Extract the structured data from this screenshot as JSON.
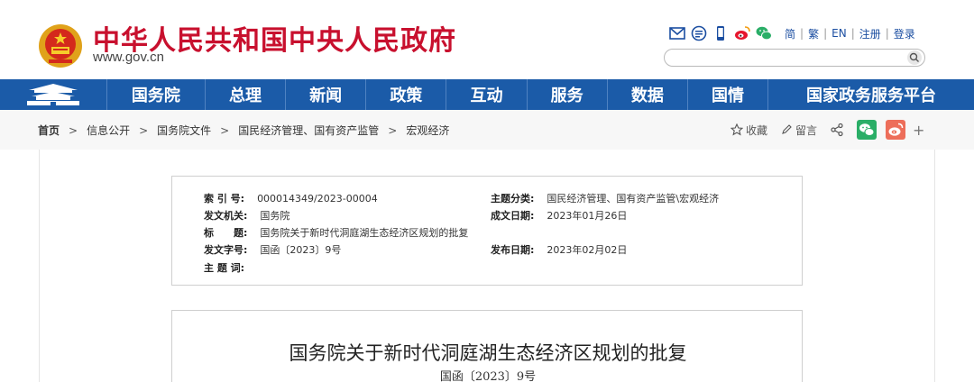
{
  "header": {
    "title": "中华人民共和国中央人民政府",
    "domain": "www.gov.cn",
    "links": [
      "简",
      "繁",
      "EN",
      "注册",
      "登录"
    ],
    "search_placeholder": ""
  },
  "nav": {
    "items": [
      "国务院",
      "总理",
      "新闻",
      "政策",
      "互动",
      "服务",
      "数据",
      "国情",
      "国家政务服务平台"
    ]
  },
  "breadcrumb": {
    "items": [
      "首页",
      "信息公开",
      "国务院文件",
      "国民经济管理、国有资产监管",
      "宏观经济"
    ]
  },
  "share": {
    "favorite": "收藏",
    "comment": "留言",
    "more": "+"
  },
  "info": {
    "index_label": "索 引 号:",
    "index_value": "000014349/2023-00004",
    "category_label": "主题分类:",
    "category_value": "国民经济管理、国有资产监管\\宏观经济",
    "issuer_label": "发文机关:",
    "issuer_value": "国务院",
    "written_label": "成文日期:",
    "written_value": "2023年01月26日",
    "title_label": "标　　题:",
    "title_value": "国务院关于新时代洞庭湖生态经济区规划的批复",
    "docno_label": "发文字号:",
    "docno_value": "国函〔2023〕9号",
    "published_label": "发布日期:",
    "published_value": "2023年02月02日",
    "keywords_label": "主 题 词:",
    "keywords_value": ""
  },
  "document": {
    "title": "国务院关于新时代洞庭湖生态经济区规划的批复",
    "number": "国函〔2023〕9号"
  },
  "colors": {
    "brand_red": "#c8102e",
    "nav_blue": "#1b5ba8",
    "link_blue": "#1b4ea1"
  }
}
